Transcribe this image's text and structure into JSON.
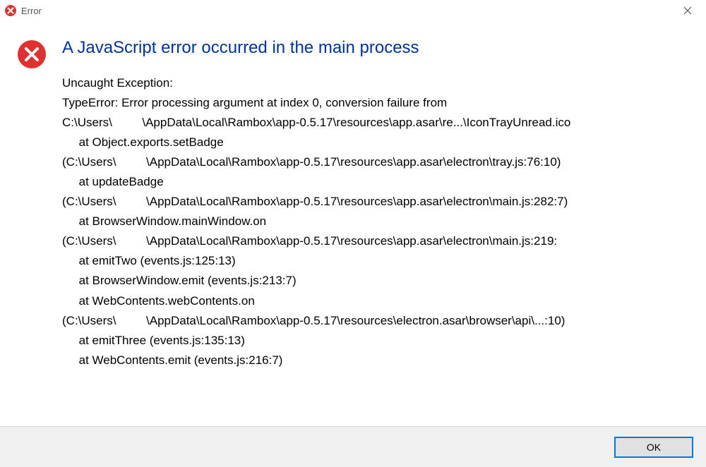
{
  "titlebar": {
    "title": "Error"
  },
  "dialog": {
    "heading": "A JavaScript error occurred in the main process",
    "body": "Uncaught Exception:\nTypeError: Error processing argument at index 0, conversion failure from\nC:\\Users\\         \\AppData\\Local\\Rambox\\app-0.5.17\\resources\\app.asar\\re...\\IconTrayUnread.ico\n     at Object.exports.setBadge\n(C:\\Users\\         \\AppData\\Local\\Rambox\\app-0.5.17\\resources\\app.asar\\electron\\tray.js:76:10)\n     at updateBadge\n(C:\\Users\\         \\AppData\\Local\\Rambox\\app-0.5.17\\resources\\app.asar\\electron\\main.js:282:7)\n     at BrowserWindow.mainWindow.on\n(C:\\Users\\         \\AppData\\Local\\Rambox\\app-0.5.17\\resources\\app.asar\\electron\\main.js:219:\n     at emitTwo (events.js:125:13)\n     at BrowserWindow.emit (events.js:213:7)\n     at WebContents.webContents.on\n(C:\\Users\\         \\AppData\\Local\\Rambox\\app-0.5.17\\resources\\electron.asar\\browser\\api\\...:10)\n     at emitThree (events.js:135:13)\n     at WebContents.emit (events.js:216:7)"
  },
  "buttons": {
    "ok_label": "OK"
  }
}
